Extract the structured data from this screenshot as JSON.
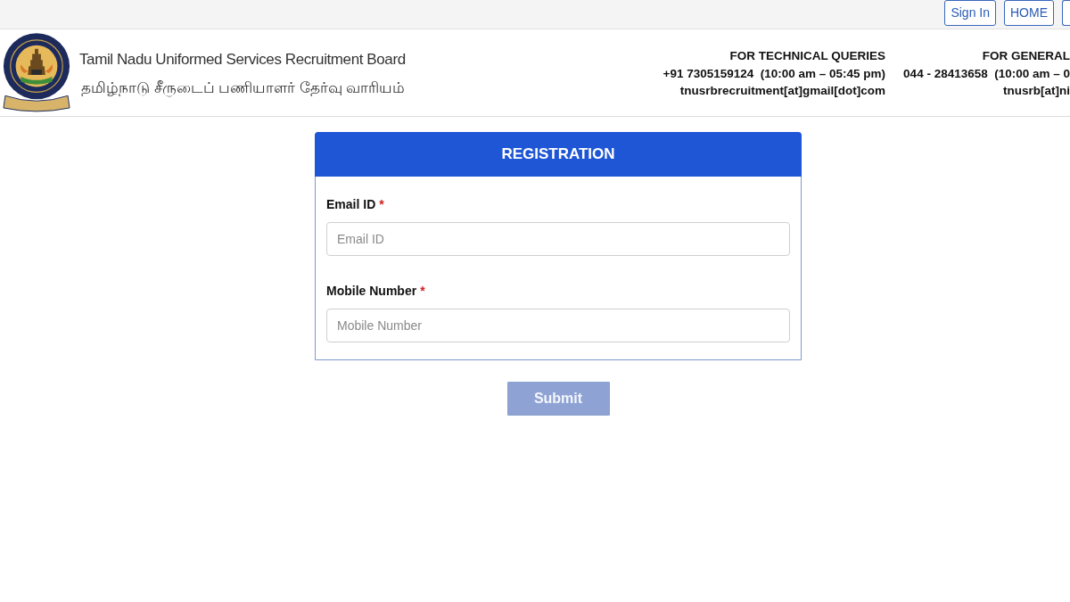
{
  "top_bar": {
    "buttons": [
      {
        "label": "Sign In"
      },
      {
        "label": "HOME"
      }
    ]
  },
  "header": {
    "title": "Tamil Nadu Uniformed Services Recruitment Board",
    "title_tamil": "தமிழ்நாடு சீருடைப் பணியாளர் தேர்வு வாரியம்",
    "contacts": [
      {
        "heading": "FOR TECHNICAL QUERIES",
        "phone": "+91 7305159124  (10:00 am – 05:45 pm)",
        "email": "tnusrbrecruitment[at]gmail[dot]com"
      },
      {
        "heading": "FOR GENERAL",
        "phone": "044 - 28413658  (10:00 am – 0",
        "email": "tnusrb[at]ni"
      }
    ]
  },
  "form": {
    "title": "REGISTRATION",
    "fields": [
      {
        "label": "Email ID",
        "required_mark": "*",
        "placeholder": "Email ID"
      },
      {
        "label": "Mobile Number",
        "required_mark": "*",
        "placeholder": "Mobile Number"
      }
    ],
    "submit": {
      "label": "Submit",
      "disabled": true
    }
  }
}
